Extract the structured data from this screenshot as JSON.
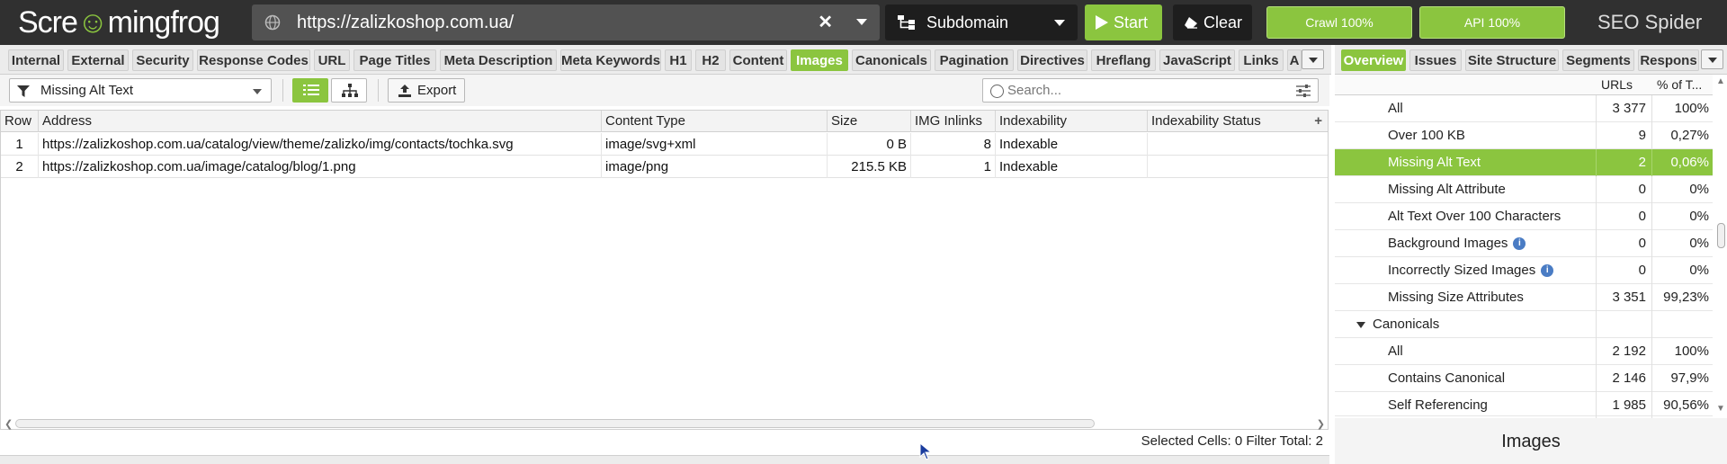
{
  "app": {
    "logo_text_a": "Scre",
    "logo_text_b": "mingfrog",
    "product": "SEO Spider"
  },
  "topbar": {
    "url": "https://zalizkoshop.com.ua/",
    "clear_symbol": "✕",
    "mode": "Subdomain",
    "start_label": "Start",
    "clear_label": "Clear",
    "crawl_label": "Crawl 100%",
    "api_label": "API 100%"
  },
  "tabs": [
    {
      "label": "Internal"
    },
    {
      "label": "External"
    },
    {
      "label": "Security"
    },
    {
      "label": "Response Codes"
    },
    {
      "label": "URL"
    },
    {
      "label": "Page Titles"
    },
    {
      "label": "Meta Description"
    },
    {
      "label": "Meta Keywords"
    },
    {
      "label": "H1"
    },
    {
      "label": "H2"
    },
    {
      "label": "Content"
    },
    {
      "label": "Images",
      "active": true
    },
    {
      "label": "Canonicals"
    },
    {
      "label": "Pagination"
    },
    {
      "label": "Directives"
    },
    {
      "label": "Hreflang"
    },
    {
      "label": "JavaScript"
    },
    {
      "label": "Links"
    },
    {
      "label": "A"
    }
  ],
  "toolbar": {
    "filter": "Missing Alt Text",
    "export_label": "Export",
    "search_placeholder": "Search..."
  },
  "grid": {
    "columns": [
      "Row",
      "Address",
      "Content Type",
      "Size",
      "IMG Inlinks",
      "Indexability",
      "Indexability Status"
    ],
    "add_column_symbol": "+",
    "rows": [
      {
        "row": "1",
        "address": "https://zalizkoshop.com.ua/catalog/view/theme/zalizko/img/contacts/tochka.svg",
        "content_type": "image/svg+xml",
        "size": "0 B",
        "inlinks": "8",
        "indexability": "Indexable",
        "status": ""
      },
      {
        "row": "2",
        "address": "https://zalizkoshop.com.ua/image/catalog/blog/1.png",
        "content_type": "image/png",
        "size": "215.5 KB",
        "inlinks": "1",
        "indexability": "Indexable",
        "status": ""
      }
    ]
  },
  "status": {
    "text": "Selected Cells:  0  Filter Total:  2"
  },
  "right_tabs": [
    "Overview",
    "Issues",
    "Site Structure",
    "Segments",
    "Respons"
  ],
  "right_panel": {
    "col_urls": "URLs",
    "col_pct": "% of T...",
    "rows": [
      {
        "name": "All",
        "urls": "3 377",
        "pct": "100%"
      },
      {
        "name": "Over 100 KB",
        "urls": "9",
        "pct": "0,27%"
      },
      {
        "name": "Missing Alt Text",
        "urls": "2",
        "pct": "0,06%",
        "selected": true
      },
      {
        "name": "Missing Alt Attribute",
        "urls": "0",
        "pct": "0%"
      },
      {
        "name": "Alt Text Over 100 Characters",
        "urls": "0",
        "pct": "0%"
      },
      {
        "name": "Background Images",
        "urls": "0",
        "pct": "0%",
        "info": true
      },
      {
        "name": "Incorrectly Sized Images",
        "urls": "0",
        "pct": "0%",
        "info": true
      },
      {
        "name": "Missing Size Attributes",
        "urls": "3 351",
        "pct": "99,23%"
      },
      {
        "name": "Canonicals",
        "urls": "",
        "pct": "",
        "group": true
      },
      {
        "name": "All",
        "urls": "2 192",
        "pct": "100%"
      },
      {
        "name": "Contains Canonical",
        "urls": "2 146",
        "pct": "97,9%"
      },
      {
        "name": "Self Referencing",
        "urls": "1 985",
        "pct": "90,56%"
      }
    ],
    "title": "Images"
  },
  "colors": {
    "accent": "#8bc53f",
    "topbar": "#303030",
    "info": "#4a7cc4"
  }
}
